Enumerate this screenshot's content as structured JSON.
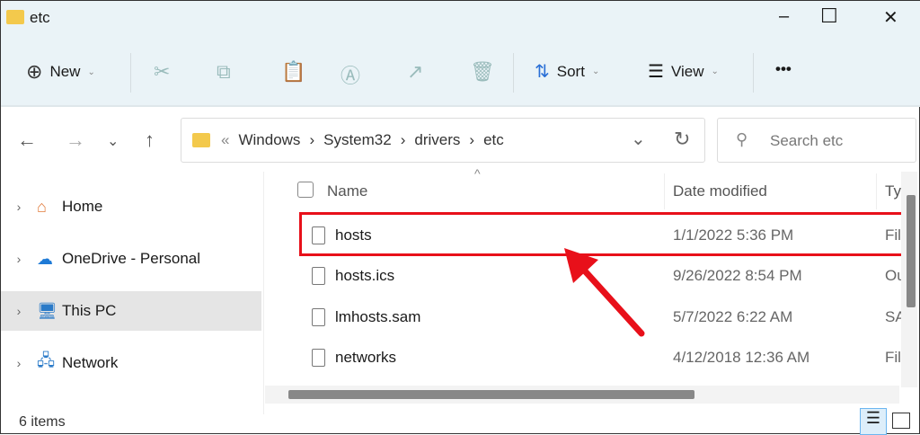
{
  "window": {
    "title": "etc",
    "minimize": "–",
    "maximize": "☐",
    "close": "✕"
  },
  "toolbar": {
    "new_label": "New",
    "sort_label": "Sort",
    "view_label": "View",
    "more": "•••"
  },
  "address": {
    "sep": "«",
    "crumbs": [
      "Windows",
      "System32",
      "drivers",
      "etc"
    ]
  },
  "search": {
    "placeholder": "Search etc"
  },
  "sidebar": {
    "items": [
      {
        "label": "Home",
        "icon": "home-icon"
      },
      {
        "label": "OneDrive - Personal",
        "icon": "cloud-icon"
      },
      {
        "label": "This PC",
        "icon": "computer-icon",
        "selected": true
      },
      {
        "label": "Network",
        "icon": "network-icon"
      }
    ]
  },
  "columns": {
    "name": "Name",
    "date": "Date modified",
    "type": "Ty"
  },
  "files": [
    {
      "name": "hosts",
      "date": "1/1/2022 5:36 PM",
      "type": "Fil"
    },
    {
      "name": "hosts.ics",
      "date": "9/26/2022 8:54 PM",
      "type": "Ou"
    },
    {
      "name": "lmhosts.sam",
      "date": "5/7/2022 6:22 AM",
      "type": "SA"
    },
    {
      "name": "networks",
      "date": "4/12/2018 12:36 AM",
      "type": "Fil"
    }
  ],
  "status": {
    "count": "6 items"
  },
  "colors": {
    "highlight": "#e8101a",
    "toolbar_bg": "#eaf3f7"
  }
}
